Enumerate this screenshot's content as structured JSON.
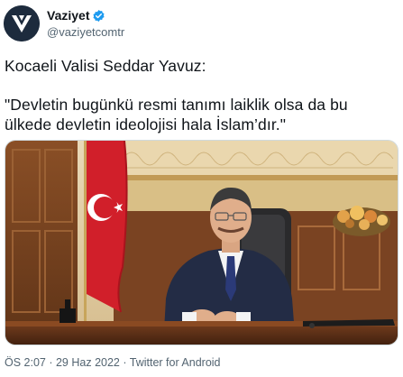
{
  "account": {
    "name": "Vaziyet",
    "handle": "@vaziyetcomtr",
    "verified": true,
    "avatar_icon": "vaziyet-logo-icon",
    "brand_color": "#1d2b3d"
  },
  "tweet": {
    "line1": "Kocaeli Valisi Seddar Yavuz:",
    "line2": "\"Devletin bugünkü resmi tanımı laiklik olsa da bu",
    "line3": "ülkede devletin ideolojisi hala İslam’dır.\""
  },
  "media": {
    "description_icon": "photo-governor-at-desk-with-turkish-flag"
  },
  "meta": {
    "time": "ÖS 2:07",
    "separator1": " · ",
    "date": "29 Haz 2022",
    "separator2": " · ",
    "source": "Twitter for Android"
  },
  "colors": {
    "text": "#0f1419",
    "secondary": "#536471",
    "verified_badge": "#1d9bf0",
    "flag_red": "#d11f2a"
  }
}
